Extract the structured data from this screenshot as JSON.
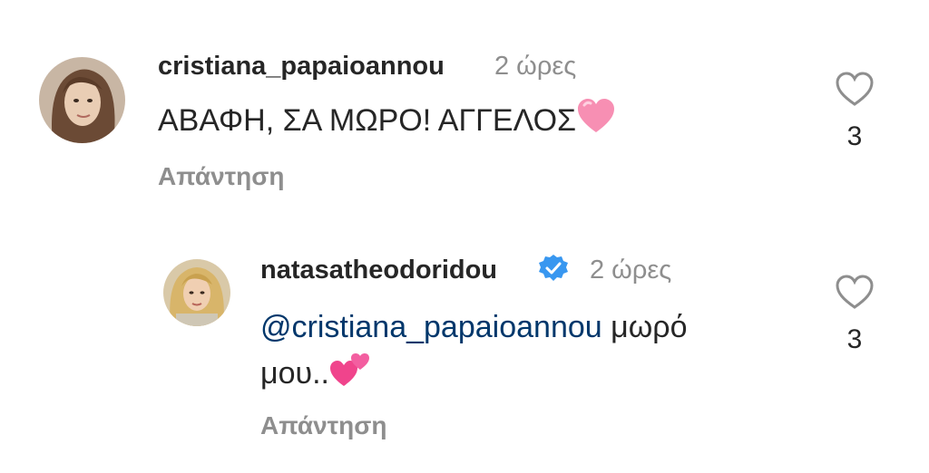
{
  "comments": [
    {
      "username": "cristiana_papaioannou",
      "time": "2 ώρες",
      "text": "ΑΒΑΦΗ, ΣΑ ΜΩΡΟ! ΑΓΓΕΛΟΣ",
      "emoji": "pink-heart",
      "reply_label": "Απάντηση",
      "likes": "3"
    },
    {
      "username": "natasatheodoridou",
      "verified": true,
      "time": "2 ώρες",
      "mention": "@cristiana_papaioannou",
      "text_after_mention": " μωρό",
      "text_line2": "μου..",
      "emoji": "two-hearts",
      "reply_label": "Απάντηση",
      "likes": "3"
    }
  ],
  "colors": {
    "text": "#262626",
    "secondary": "#8e8e8e",
    "mention": "#00376b",
    "verified": "#3897f0",
    "heart_emoji": "#f78fb3"
  },
  "icons": [
    "heart-outline-icon",
    "verified-badge-icon"
  ]
}
